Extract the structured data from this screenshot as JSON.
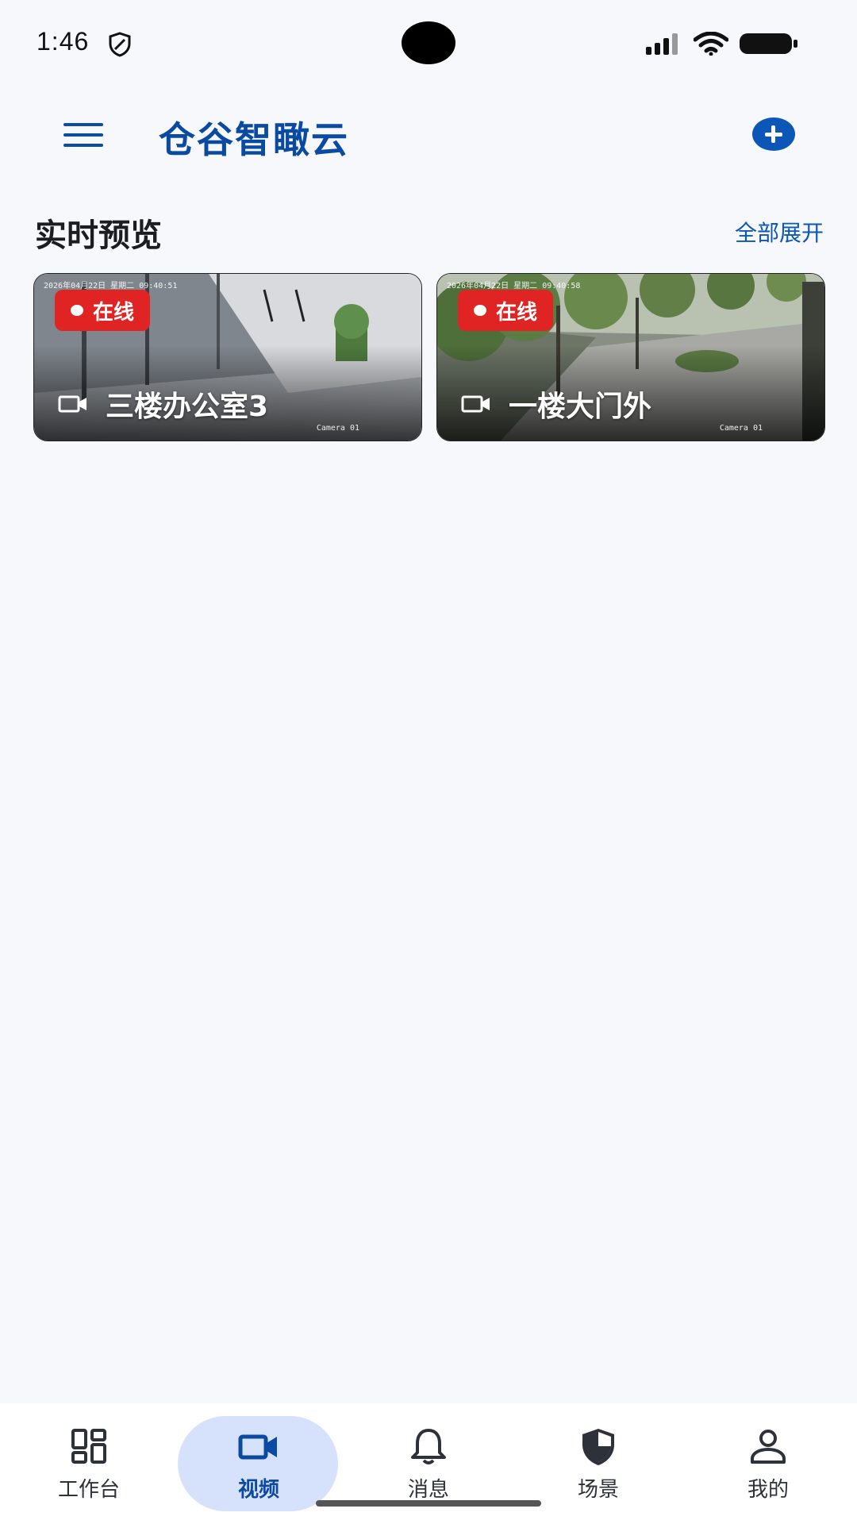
{
  "status_bar": {
    "time": "1:46"
  },
  "header": {
    "title": "仓谷智瞰云"
  },
  "section": {
    "title": "实时预览",
    "expand_label": "全部展开"
  },
  "cameras": [
    {
      "name": "三楼办公室3",
      "status": "在线",
      "osd": "2026年04月22日 星期二 09:40:51",
      "watermark": "Camera 01"
    },
    {
      "name": "一楼大门外",
      "status": "在线",
      "osd": "2026年04月22日 星期二 09:40:58",
      "watermark": "Camera 01"
    }
  ],
  "nav": {
    "items": [
      {
        "label": "工作台",
        "icon": "dashboard-icon"
      },
      {
        "label": "视频",
        "icon": "video-camera-icon"
      },
      {
        "label": "消息",
        "icon": "bell-icon"
      },
      {
        "label": "场景",
        "icon": "shield-icon"
      },
      {
        "label": "我的",
        "icon": "person-icon"
      }
    ],
    "active_index": 1
  },
  "colors": {
    "brand": "#0b4aa1",
    "accent": "#0b56b6",
    "badge_red": "#e02424",
    "active_pill": "#d6e2fb",
    "background": "#f6f8fc"
  }
}
